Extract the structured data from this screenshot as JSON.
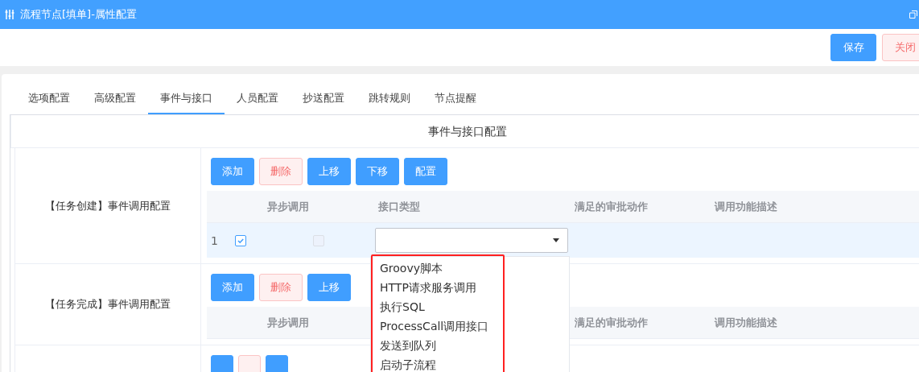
{
  "window": {
    "title": "流程节点[填单]-属性配置"
  },
  "toolbar": {
    "buttons": [
      {
        "label": "保存",
        "kind": "primary"
      },
      {
        "label": "关闭",
        "kind": "danger"
      }
    ]
  },
  "tabs": [
    {
      "label": "选项配置",
      "selected": false
    },
    {
      "label": "高级配置",
      "selected": false
    },
    {
      "label": "事件与接口",
      "selected": true
    },
    {
      "label": "人员配置",
      "selected": false
    },
    {
      "label": "抄送配置",
      "selected": false
    },
    {
      "label": "跳转规则",
      "selected": false
    },
    {
      "label": "节点提醒",
      "selected": false
    }
  ],
  "panel": {
    "title": "事件与接口配置",
    "sections": [
      {
        "label": "【任务创建】事件调用配置",
        "buttons": [
          {
            "label": "添加",
            "kind": "primary"
          },
          {
            "label": "删除",
            "kind": "danger"
          },
          {
            "label": "上移",
            "kind": "primary"
          },
          {
            "label": "下移",
            "kind": "primary"
          },
          {
            "label": "配置",
            "kind": "primary"
          }
        ],
        "columns": [
          {
            "kind": "async",
            "label": "异步调用"
          },
          {
            "kind": "interface",
            "label": "接口类型"
          },
          {
            "kind": "actions",
            "label": "满足的审批动作"
          },
          {
            "kind": "description",
            "label": "调用功能描述"
          }
        ],
        "rows": [
          {
            "index": "1",
            "checked": true,
            "async": {
              "checked": false,
              "disabled": true
            },
            "interface_dropdown": {
              "expanded": true,
              "options": [
                "Groovy脚本",
                "HTTP请求服务调用",
                "执行SQL",
                "ProcessCall调用接口",
                "发送到队列",
                "启动子流程"
              ]
            }
          }
        ]
      },
      {
        "label": "【任务完成】事件调用配置",
        "buttons": [
          {
            "label": "添加",
            "kind": "primary"
          },
          {
            "label": "删除",
            "kind": "danger"
          },
          {
            "label": "上移",
            "kind": "primary"
          }
        ],
        "columns": [
          {
            "kind": "async",
            "label": "异步调用"
          },
          {
            "kind": "actions",
            "label": "满足的审批动作"
          },
          {
            "kind": "description",
            "label": "调用功能描述"
          }
        ]
      },
      {
        "buttons": [
          {
            "kind": "primary"
          },
          {
            "kind": "danger"
          },
          {
            "kind": "primary"
          }
        ]
      }
    ]
  }
}
